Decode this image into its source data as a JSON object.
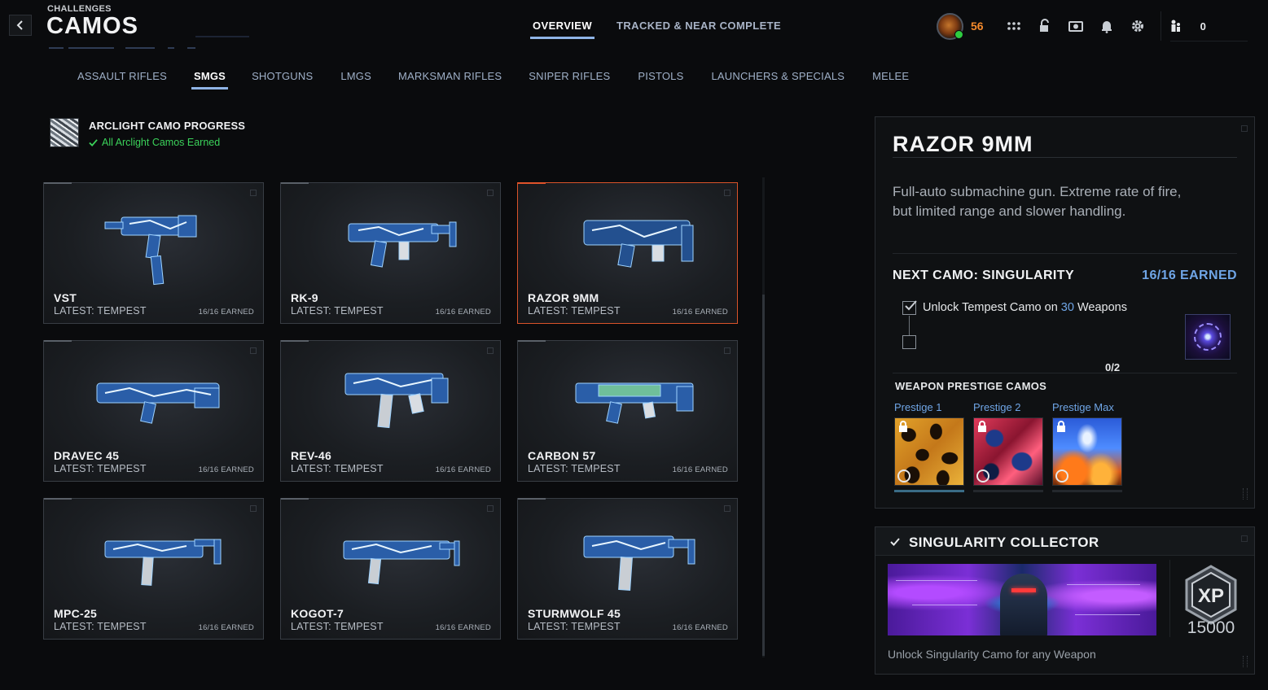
{
  "header": {
    "breadcrumb": "CHALLENGES",
    "title": "CAMOS",
    "tabs": [
      {
        "label": "OVERVIEW",
        "active": true
      },
      {
        "label": "TRACKED & NEAR COMPLETE",
        "active": false
      }
    ],
    "player_level": "56",
    "party_count": "0",
    "icons": [
      "grid-icon",
      "lock-icon",
      "camera-icon",
      "bell-icon",
      "gear-icon",
      "party-icon"
    ]
  },
  "categories": [
    {
      "label": "ASSAULT RIFLES",
      "active": false
    },
    {
      "label": "SMGS",
      "active": true
    },
    {
      "label": "SHOTGUNS",
      "active": false
    },
    {
      "label": "LMGS",
      "active": false
    },
    {
      "label": "MARKSMAN RIFLES",
      "active": false
    },
    {
      "label": "SNIPER RIFLES",
      "active": false
    },
    {
      "label": "PISTOLS",
      "active": false
    },
    {
      "label": "LAUNCHERS & SPECIALS",
      "active": false
    },
    {
      "label": "MELEE",
      "active": false
    }
  ],
  "arclight": {
    "title": "ARCLIGHT CAMO PROGRESS",
    "status": "All Arclight Camos Earned"
  },
  "weapons": [
    {
      "name": "VST",
      "latest": "LATEST: TEMPEST",
      "earned": "16/16 EARNED",
      "selected": false
    },
    {
      "name": "RK-9",
      "latest": "LATEST: TEMPEST",
      "earned": "16/16 EARNED",
      "selected": false
    },
    {
      "name": "RAZOR 9MM",
      "latest": "LATEST: TEMPEST",
      "earned": "16/16 EARNED",
      "selected": true
    },
    {
      "name": "DRAVEC 45",
      "latest": "LATEST: TEMPEST",
      "earned": "16/16 EARNED",
      "selected": false
    },
    {
      "name": "REV-46",
      "latest": "LATEST: TEMPEST",
      "earned": "16/16 EARNED",
      "selected": false
    },
    {
      "name": "CARBON 57",
      "latest": "LATEST: TEMPEST",
      "earned": "16/16 EARNED",
      "selected": false
    },
    {
      "name": "MPC-25",
      "latest": "LATEST: TEMPEST",
      "earned": "16/16 EARNED",
      "selected": false
    },
    {
      "name": "KOGOT-7",
      "latest": "LATEST: TEMPEST",
      "earned": "16/16 EARNED",
      "selected": false
    },
    {
      "name": "STURMWOLF 45",
      "latest": "LATEST: TEMPEST",
      "earned": "16/16 EARNED",
      "selected": false
    }
  ],
  "detail": {
    "weapon_name": "RAZOR 9MM",
    "description_line1": "Full-auto submachine gun. Extreme rate of fire,",
    "description_line2": "but limited range and slower handling.",
    "next_camo_label": "NEXT CAMO: SINGULARITY",
    "next_camo_earned": "16/16 EARNED",
    "requirement_pre": "Unlock Tempest Camo on ",
    "requirement_count": "30",
    "requirement_post": " Weapons",
    "requirement_checked": true,
    "requirement_progress": "0/2",
    "prestige_heading": "WEAPON PRESTIGE CAMOS",
    "prestige_camos": [
      {
        "label": "Prestige 1",
        "locked": true
      },
      {
        "label": "Prestige 2",
        "locked": true
      },
      {
        "label": "Prestige Max",
        "locked": true
      }
    ]
  },
  "collector": {
    "title": "SINGULARITY COLLECTOR",
    "xp_label": "XP",
    "xp_amount": "15000",
    "description": "Unlock Singularity Camo for any Weapon"
  },
  "colors": {
    "accent_blue": "#6fa5e6",
    "selected_border": "#d9532a",
    "level_orange": "#f58a2b",
    "success_green": "#3bd25a"
  }
}
